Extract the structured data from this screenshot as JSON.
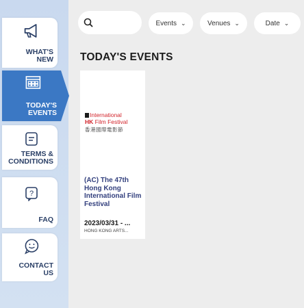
{
  "sidebar": {
    "items": [
      {
        "label": "WHAT'S\nNEW",
        "icon": "megaphone-icon"
      },
      {
        "label": "TODAY'S\nEVENTS",
        "icon": "theater-icon"
      },
      {
        "label": "TERMS &\nCONDITIONS",
        "icon": "document-icon"
      },
      {
        "label": "FAQ",
        "icon": "question-icon"
      },
      {
        "label": "CONTACT\nUS",
        "icon": "smiley-chat-icon"
      }
    ]
  },
  "filters": {
    "search_icon": "search-icon",
    "events": "Events",
    "venues": "Venues",
    "date": "Date"
  },
  "main": {
    "title": "TODAY'S EVENTS"
  },
  "events": [
    {
      "logo_line1": "International",
      "logo_hk": "HK",
      "logo_line2": "Film Festival",
      "logo_chinese": "香港國際電影節",
      "title": "(AC) The 47th Hong Kong International Film Festival",
      "date": "2023/03/31 - ...",
      "venue": "HONG KONG ARTS..."
    }
  ],
  "colors": {
    "accent": "#3b78c4",
    "nav_text": "#2a3f66",
    "event_title": "#33407e",
    "brand_red": "#d2232a"
  }
}
